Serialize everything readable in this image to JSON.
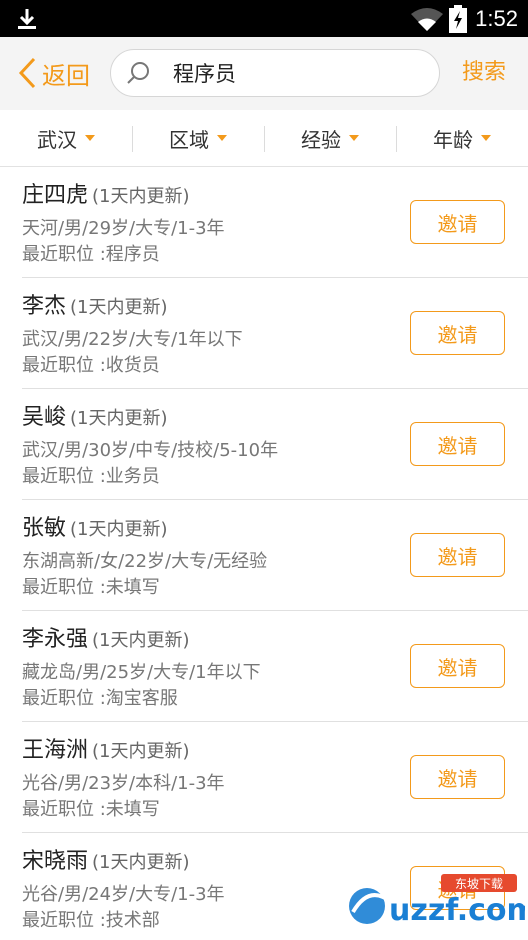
{
  "statusbar": {
    "time": "1:52",
    "icons": [
      "download-icon",
      "wifi-icon",
      "battery-charging-icon"
    ]
  },
  "header": {
    "back_label": "返回",
    "search_value": "程序员",
    "search_button": "搜索"
  },
  "filters": [
    {
      "label": "武汉"
    },
    {
      "label": "区域"
    },
    {
      "label": "经验"
    },
    {
      "label": "年龄"
    }
  ],
  "candidates": [
    {
      "name": "庄四虎",
      "updated": "(1天内更新)",
      "info": "天河/男/29岁/大专/1-3年",
      "position": "最近职位 :程序员",
      "action": "邀请"
    },
    {
      "name": "李杰",
      "updated": "(1天内更新)",
      "info": "武汉/男/22岁/大专/1年以下",
      "position": "最近职位 :收货员",
      "action": "邀请"
    },
    {
      "name": "吴峻",
      "updated": "(1天内更新)",
      "info": "武汉/男/30岁/中专/技校/5-10年",
      "position": "最近职位 :业务员",
      "action": "邀请"
    },
    {
      "name": "张敏",
      "updated": "(1天内更新)",
      "info": "东湖高新/女/22岁/大专/无经验",
      "position": "最近职位 :未填写",
      "action": "邀请"
    },
    {
      "name": "李永强",
      "updated": "(1天内更新)",
      "info": "藏龙岛/男/25岁/大专/1年以下",
      "position": "最近职位 :淘宝客服",
      "action": "邀请"
    },
    {
      "name": "王海洲",
      "updated": "(1天内更新)",
      "info": "光谷/男/23岁/本科/1-3年",
      "position": "最近职位 :未填写",
      "action": "邀请"
    },
    {
      "name": "宋晓雨",
      "updated": "(1天内更新)",
      "info": "光谷/男/24岁/大专/1-3年",
      "position": "最近职位 :技术部",
      "action": "邀请"
    }
  ],
  "watermark": {
    "text": "uzzf.com",
    "badge": "东坡下载"
  },
  "colors": {
    "accent": "#f39a1b",
    "header_bg": "#f4f4f4",
    "divider": "#e0e0e0"
  }
}
